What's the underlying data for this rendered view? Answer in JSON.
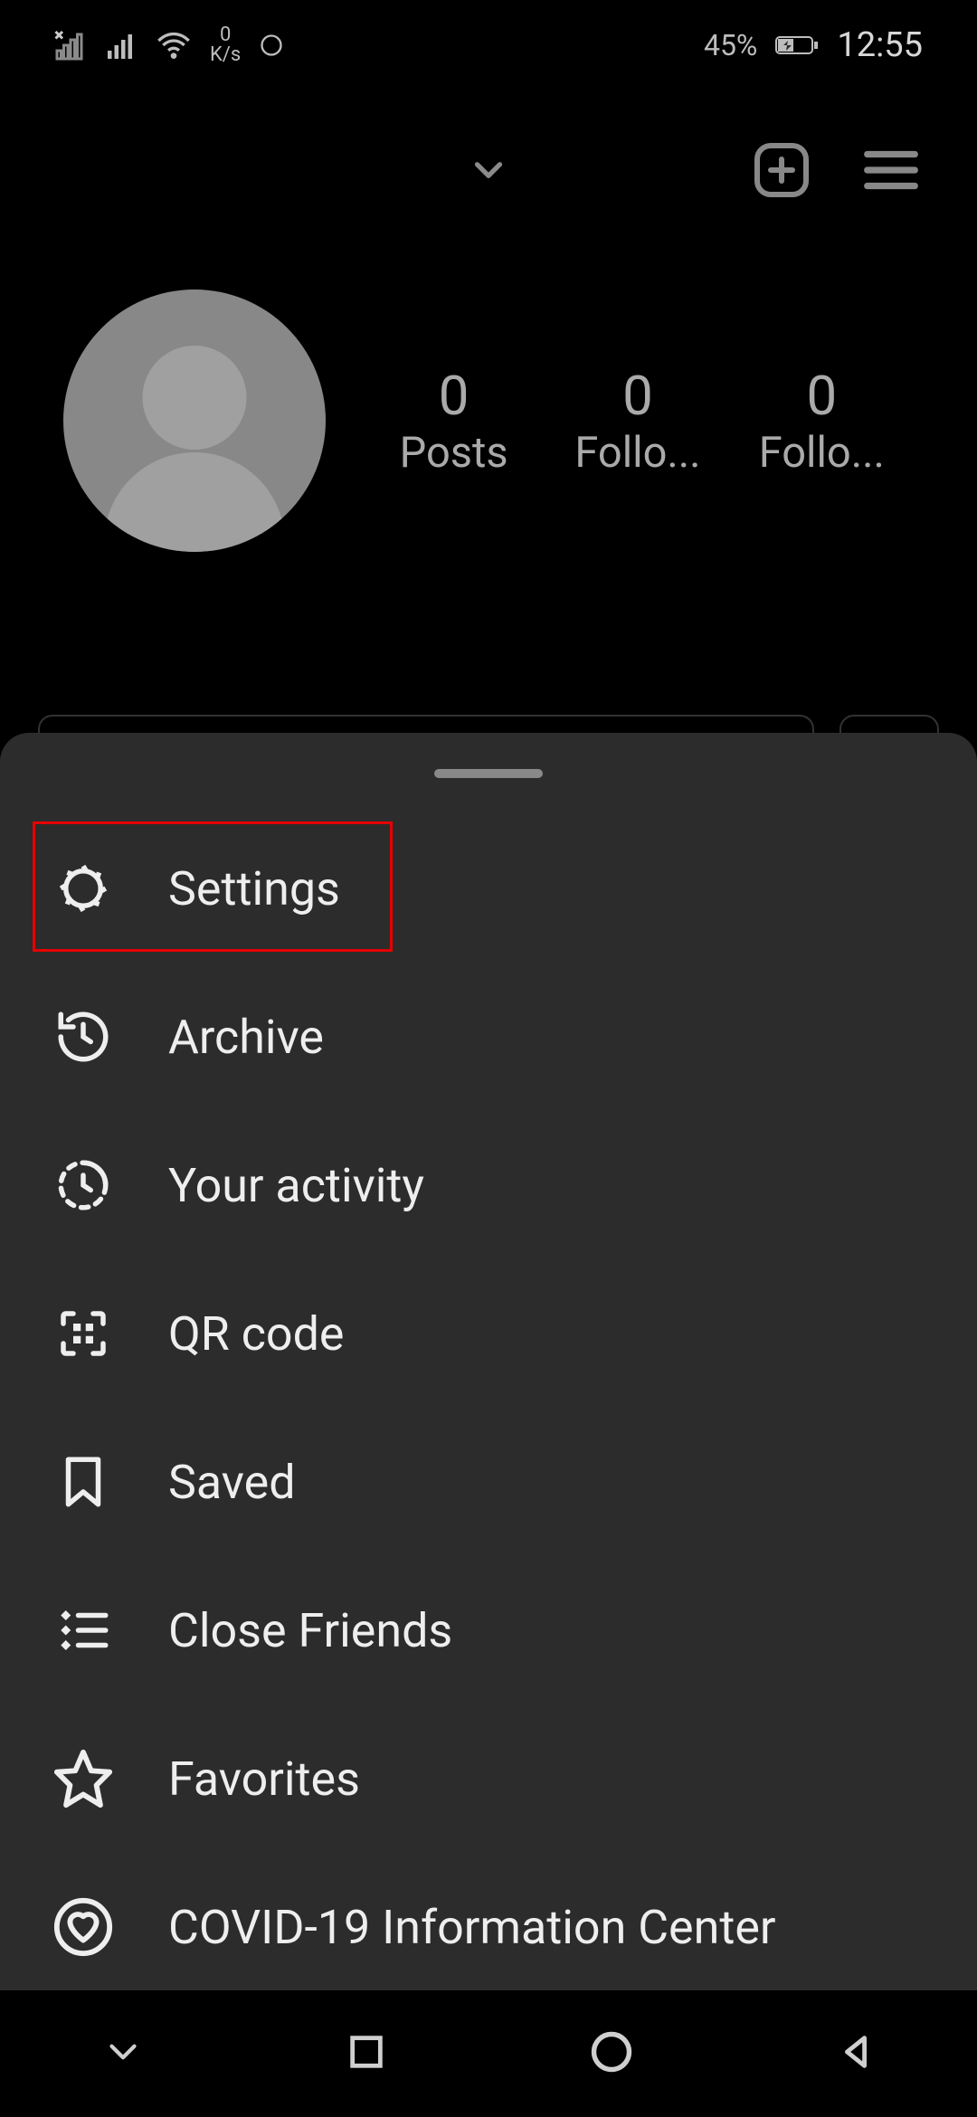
{
  "status_bar": {
    "data_rate_value": "0",
    "data_rate_unit": "K/s",
    "battery_pct": "45%",
    "time": "12:55"
  },
  "profile": {
    "stats": [
      {
        "count": "0",
        "label": "Posts"
      },
      {
        "count": "0",
        "label": "Follo..."
      },
      {
        "count": "0",
        "label": "Follo..."
      }
    ]
  },
  "menu": {
    "items": [
      {
        "label": "Settings"
      },
      {
        "label": "Archive"
      },
      {
        "label": "Your activity"
      },
      {
        "label": "QR code"
      },
      {
        "label": "Saved"
      },
      {
        "label": "Close Friends"
      },
      {
        "label": "Favorites"
      },
      {
        "label": "COVID-19 Information Center"
      }
    ]
  },
  "colors": {
    "sheet_bg": "#2c2c2c",
    "highlight": "#e60000",
    "text_secondary": "#aaaaaa",
    "icon": "#eeeeee"
  }
}
